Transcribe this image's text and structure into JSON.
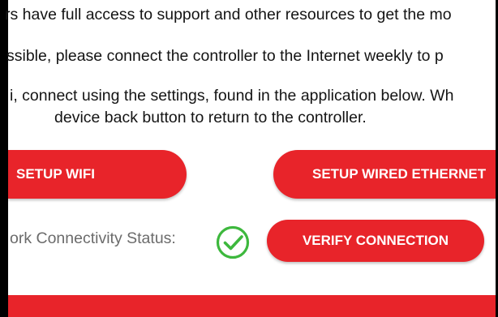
{
  "text": {
    "line1": "rs have full access to support and other resources to get the mo",
    "line2": "ssible, please connect the controller to the Internet weekly to p",
    "line3a": "i, connect using the settings, found in the application below. Wh",
    "line3b": "device back button to return to the controller."
  },
  "buttons": {
    "setup_wifi": "SETUP WIFI",
    "setup_wired_ethernet": "SETUP WIRED ETHERNET",
    "verify_connection": "VERIFY CONNECTION"
  },
  "status": {
    "label": "ork Connectivity Status:",
    "icon": "check-circle-icon",
    "icon_color": "#3db83d"
  },
  "colors": {
    "accent": "#e8242a",
    "button_text": "#ffffff"
  }
}
